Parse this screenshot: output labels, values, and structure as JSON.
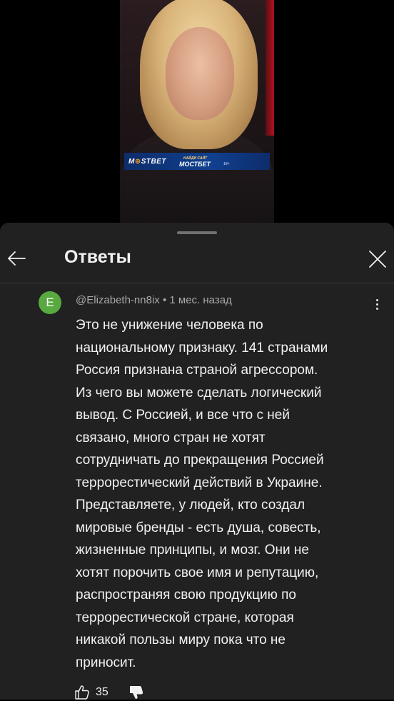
{
  "video": {
    "banner_brand_prefix": "M",
    "banner_brand_o": "⊕",
    "banner_brand_suffix": "STBET",
    "banner_slogan_small": "НАЙДИ САЙТ",
    "banner_slogan_big": "МОСТБЕТ",
    "banner_tag": "18+"
  },
  "sheet": {
    "title": "Ответы",
    "back_icon": "arrow-left-icon",
    "close_icon": "close-icon"
  },
  "comment": {
    "avatar_letter": "E",
    "avatar_color": "#58a93f",
    "meta": "@Elizabeth-nn8ix • 1 мес. назад",
    "lines": [
      "Это не унижение человека по",
      "национальному признаку. 141 странами",
      "Россия признана страной агрессором.",
      "Из чего вы можете сделать логический",
      "вывод. С Россией, и все что с ней",
      "связано, много стран не хотят",
      "сотрудничать до прекращения Россией",
      "террорестический действий в Украине.",
      "Представляете, у людей, кто создал",
      "мировые бренды - есть душа, совесть,",
      "жизненные принципы, и мозг. Они не",
      "хотят порочить свое имя и репутацию,",
      "распространяя свою продукцию по",
      "террорестической стране, которая",
      "никакой пользы миру пока что не",
      "приносит."
    ],
    "like_count": "35",
    "like_icon": "thumbs-up-icon",
    "dislike_icon": "thumbs-down-icon",
    "more_icon": "more-vertical-icon"
  },
  "colors": {
    "sheet_background": "#212121",
    "text_primary": "#f1f1f1",
    "text_secondary": "#aaaaaa"
  }
}
